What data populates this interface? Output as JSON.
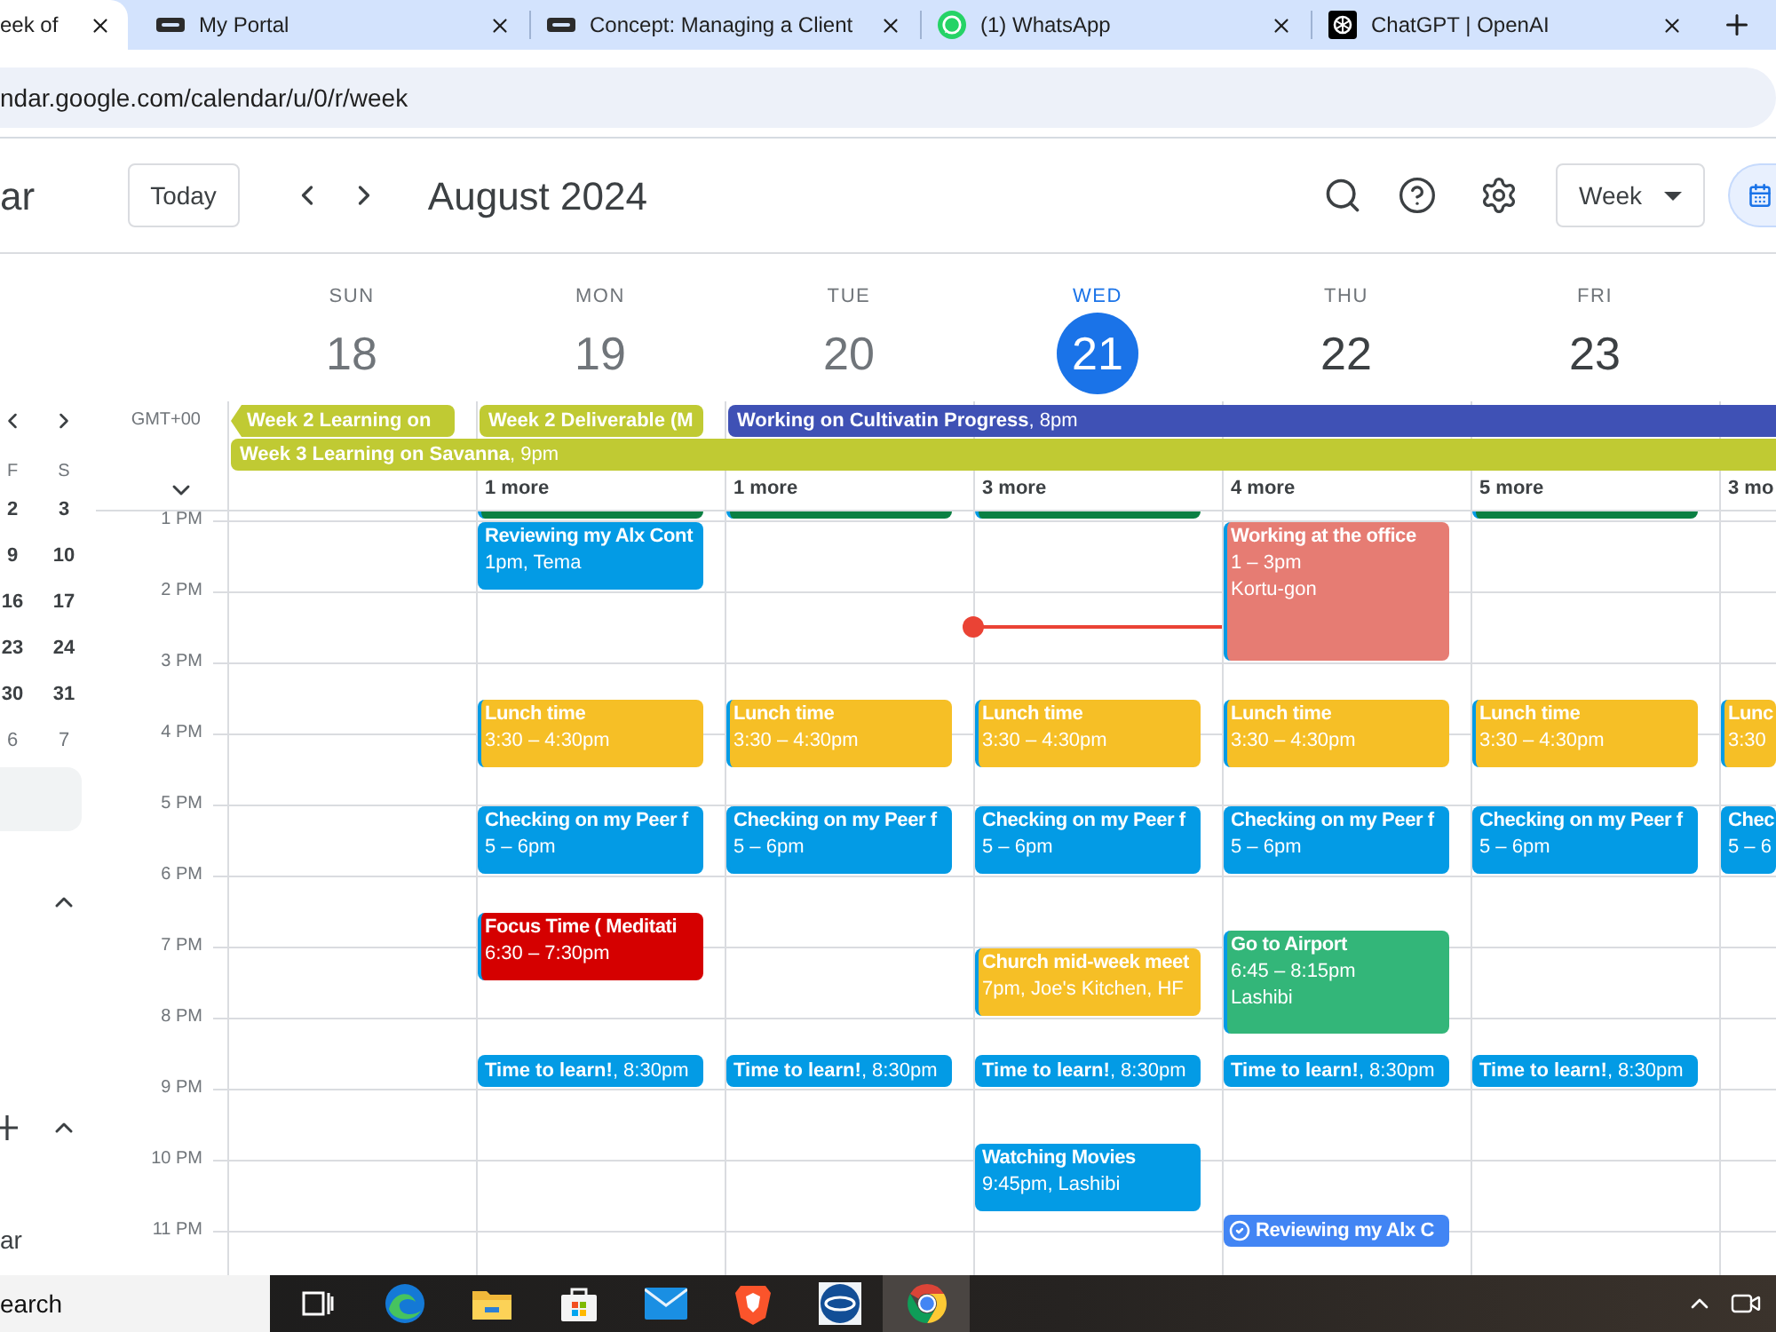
{
  "browser": {
    "tabs": [
      {
        "title": "eek of",
        "kind": "none",
        "selected": true
      },
      {
        "title": "My Portal",
        "kind": "logo",
        "selected": false
      },
      {
        "title": "Concept: Managing a Client",
        "kind": "logo",
        "selected": false
      },
      {
        "title": "(1) WhatsApp",
        "kind": "chat",
        "selected": false
      },
      {
        "title": "ChatGPT | OpenAI",
        "kind": "knot",
        "selected": false
      }
    ],
    "address": "ndar.google.com/calendar/u/0/r/week"
  },
  "header": {
    "title": "ar",
    "today_button": "Today",
    "period": "August 2024",
    "view": "Week"
  },
  "sidebar": {
    "weekdays": [
      "F",
      "S"
    ],
    "weeks": [
      [
        {
          "day": "2",
          "other_month": false
        },
        {
          "day": "3",
          "other_month": false
        }
      ],
      [
        {
          "day": "9",
          "other_month": false
        },
        {
          "day": "10",
          "other_month": false
        }
      ],
      [
        {
          "day": "16",
          "other_month": false
        },
        {
          "day": "17",
          "other_month": false
        }
      ],
      [
        {
          "day": "23",
          "other_month": false
        },
        {
          "day": "24",
          "other_month": false
        }
      ],
      [
        {
          "day": "30",
          "other_month": false
        },
        {
          "day": "31",
          "other_month": false
        }
      ],
      [
        {
          "day": "6",
          "other_month": true
        },
        {
          "day": "7",
          "other_month": true
        }
      ]
    ],
    "footer_label": "ar"
  },
  "timezone": "GMT+00",
  "hours": [
    "1 PM",
    "2 PM",
    "3 PM",
    "4 PM",
    "5 PM",
    "6 PM",
    "7 PM",
    "8 PM",
    "9 PM",
    "10 PM",
    "11 PM"
  ],
  "allday": [
    [
      {
        "kind": "plain",
        "title": "Week 2 Learning on",
        "continued": true,
        "color": "#c0ca33"
      },
      {
        "kind": "plain",
        "title": "Week 2 Deliverable (M",
        "continued": false,
        "color": "#c0ca33"
      },
      {
        "kind": "timed",
        "title": "**Working on Cultivatin Progress**, 8pm",
        "continued": false,
        "color": "#3f51b5"
      }
    ],
    [
      {
        "kind": "timed",
        "title": "**Week 3 Learning on Savanna**, 9pm",
        "continued": false,
        "color": "#c0ca33"
      }
    ]
  ],
  "days": [
    {
      "weekday": "SUN",
      "date": "18",
      "past": true,
      "today": false
    },
    {
      "weekday": "MON",
      "date": "19",
      "past": true,
      "today": false,
      "more": "1 more",
      "events": [
        {
          "kind": "block",
          "color": "#0b8043"
        },
        {
          "kind": "block",
          "title": "Reviewing my Alx Cont",
          "details": [
            "1pm, Tema"
          ],
          "color": "#039be5"
        },
        {
          "kind": "block",
          "title": "Lunch time",
          "details": [
            "3:30 – 4:30pm"
          ],
          "color": "#f6bf26"
        },
        {
          "kind": "block",
          "title": "Checking on my Peer f",
          "details": [
            "5 – 6pm"
          ],
          "color": "#039be5"
        },
        {
          "kind": "block",
          "title": "Focus Time ( Meditati",
          "details": [
            "6:30 – 7:30pm"
          ],
          "color": "#d50000"
        },
        {
          "kind": "compact",
          "title": "**Time to learn!**, 8:30pm",
          "color": "#039be5"
        }
      ]
    },
    {
      "weekday": "TUE",
      "date": "20",
      "past": true,
      "today": false,
      "more": "1 more",
      "events": [
        {
          "kind": "block",
          "color": "#0b8043"
        },
        {
          "kind": "block",
          "title": "Lunch time",
          "details": [
            "3:30 – 4:30pm"
          ],
          "color": "#f6bf26"
        },
        {
          "kind": "block",
          "title": "Checking on my Peer f",
          "details": [
            "5 – 6pm"
          ],
          "color": "#039be5"
        },
        {
          "kind": "compact",
          "title": "**Time to learn!**, 8:30pm",
          "color": "#039be5"
        }
      ]
    },
    {
      "weekday": "WED",
      "date": "21",
      "past": false,
      "today": true,
      "more": "3 more",
      "events": [
        {
          "kind": "block",
          "color": "#0b8043"
        },
        {
          "kind": "block",
          "title": "Lunch time",
          "details": [
            "3:30 – 4:30pm"
          ],
          "color": "#f6bf26"
        },
        {
          "kind": "block",
          "title": "Checking on my Peer f",
          "details": [
            "5 – 6pm"
          ],
          "color": "#039be5"
        },
        {
          "kind": "block",
          "title": "Church mid-week meet",
          "details": [
            "7pm, Joe's Kitchen, HF"
          ],
          "color": "#f6bf26"
        },
        {
          "kind": "compact",
          "title": "**Time to learn!**, 8:30pm",
          "color": "#039be5"
        },
        {
          "kind": "block",
          "title": "Watching Movies",
          "details": [
            "9:45pm, Lashibi"
          ],
          "color": "#039be5"
        }
      ]
    },
    {
      "weekday": "THU",
      "date": "22",
      "past": false,
      "today": false,
      "more": "4 more",
      "events": [
        {
          "kind": "block",
          "title": "Working at the office",
          "details": [
            "1 – 3pm",
            "Kortu-gon"
          ],
          "color": "#e67c73"
        },
        {
          "kind": "block",
          "title": "Lunch time",
          "details": [
            "3:30 – 4:30pm"
          ],
          "color": "#f6bf26"
        },
        {
          "kind": "block",
          "title": "Checking on my Peer f",
          "details": [
            "5 – 6pm"
          ],
          "color": "#039be5"
        },
        {
          "kind": "block",
          "title": "Go to Airport",
          "details": [
            "6:45 – 8:15pm",
            "Lashibi"
          ],
          "color": "#33b679"
        },
        {
          "kind": "compact",
          "title": "**Time to learn!**, 8:30pm",
          "color": "#039be5"
        },
        {
          "kind": "task",
          "title": "Reviewing my Alx C",
          "color": "#4285f4"
        }
      ]
    },
    {
      "weekday": "FRI",
      "date": "23",
      "past": false,
      "today": false,
      "more": "5 more",
      "events": [
        {
          "kind": "block",
          "color": "#0b8043"
        },
        {
          "kind": "block",
          "title": "Lunch time",
          "details": [
            "3:30 – 4:30pm"
          ],
          "color": "#f6bf26"
        },
        {
          "kind": "block",
          "title": "Checking on my Peer f",
          "details": [
            "5 – 6pm"
          ],
          "color": "#039be5"
        },
        {
          "kind": "compact",
          "title": "**Time to learn!**, 8:30pm",
          "color": "#039be5"
        }
      ]
    },
    {
      "more": "3 mo",
      "events": [
        {
          "kind": "block",
          "title": "Lunc",
          "details": [
            "3:30"
          ],
          "color": "#f6bf26"
        },
        {
          "kind": "block",
          "title": "Chec",
          "details": [
            "5 – 6"
          ],
          "color": "#039be5"
        }
      ]
    }
  ],
  "taskbar": {
    "search": "earch",
    "apps": [
      {
        "kind": "task-view",
        "selected": false
      },
      {
        "kind": "swirl",
        "selected": false
      },
      {
        "kind": "folder",
        "selected": false
      },
      {
        "kind": "store",
        "selected": false
      },
      {
        "kind": "mail",
        "selected": false
      },
      {
        "kind": "lion",
        "selected": false
      },
      {
        "kind": "pos",
        "selected": false
      },
      {
        "kind": "chrome",
        "selected": true
      }
    ]
  }
}
